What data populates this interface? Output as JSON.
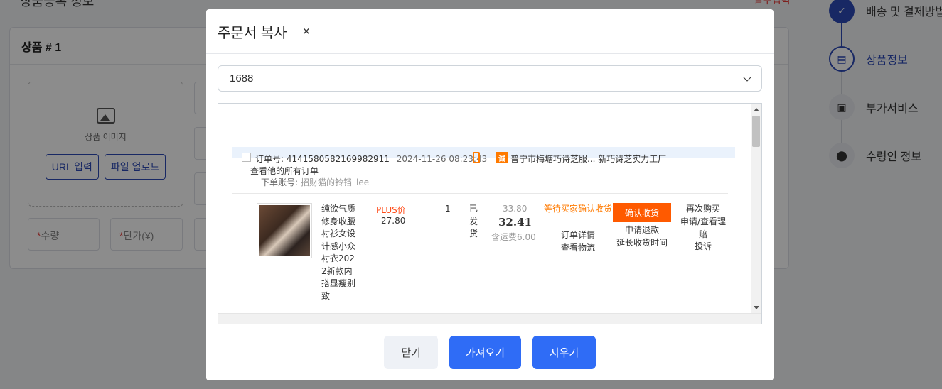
{
  "background": {
    "top_text": "상품등록 정보",
    "top_red": "필수입력",
    "card_title": "상품 # 1",
    "image_label": "상품 이미지",
    "url_button": "URL 입력",
    "upload_button": "파일 업로드",
    "qty_label": "수량",
    "price_label": "단가(¥)",
    "steps": [
      {
        "label": "배송 및 결제방법",
        "state": "done",
        "icon": "check-icon"
      },
      {
        "label": "상품정보",
        "state": "active",
        "icon": "document-icon"
      },
      {
        "label": "부가서비스",
        "state": "todo",
        "icon": "gift-icon"
      },
      {
        "label": "수령인 정보",
        "state": "todo",
        "icon": "location-pin-icon"
      }
    ]
  },
  "modal": {
    "title": "주문서 복사",
    "close_symbol": "×",
    "source_select": {
      "value": "1688"
    },
    "order": {
      "order_no_label": "订单号:",
      "order_no": "4141580582169982911",
      "date": "2024-11-26 08:23:43",
      "shop_icon_text": "诚",
      "shop_name": "普宁市梅塘巧诗芝服... 新巧诗芝实力工厂",
      "view_all": "查看他的所有订单",
      "account_label": "下单账号:",
      "account": "招财猫的铃铛_lee",
      "product_name": "纯欲气质修身收腰衬衫女设计感小众衬衣2022新款内搭显瘦别致",
      "plus_label": "PLUS价",
      "plus_price": "27.80",
      "quantity": "1",
      "shipping_state": "已发货",
      "original_price": "33.80",
      "final_price": "32.41",
      "shipping_fee": "含运费6.00",
      "status": "等待买家确认收货",
      "status_links": [
        "订单详情",
        "查看物流"
      ],
      "confirm_button": "确认收货",
      "actions": [
        "申请退款",
        "延长收货时间"
      ],
      "more_actions": [
        "再次购买",
        "申请/查看理赔",
        "投诉"
      ]
    },
    "buttons": {
      "close": "닫기",
      "fetch": "가져오기",
      "clear": "지우기"
    }
  }
}
